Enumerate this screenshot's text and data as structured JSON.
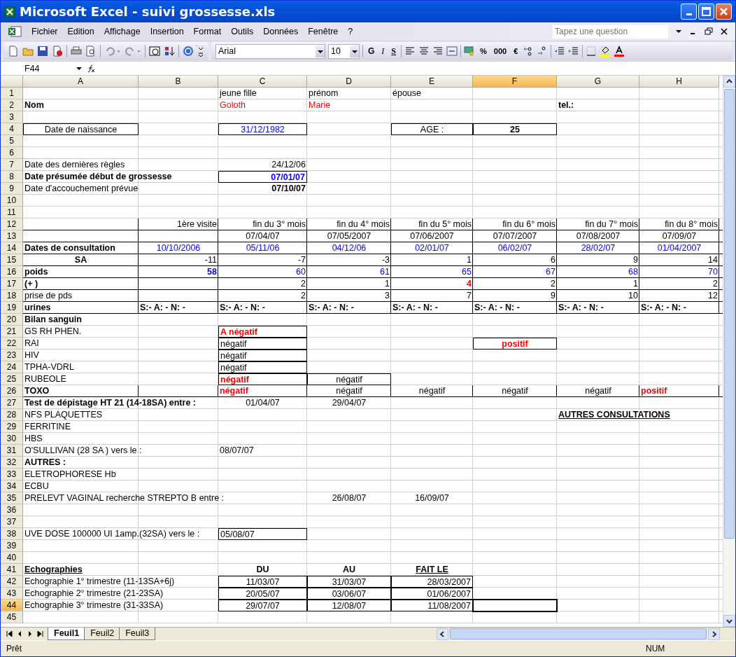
{
  "window": {
    "title": "Microsoft Excel - suivi grossesse.xls"
  },
  "menu": [
    "Fichier",
    "Edition",
    "Affichage",
    "Insertion",
    "Format",
    "Outils",
    "Données",
    "Fenêtre",
    "?"
  ],
  "help_box": {
    "placeholder": "Tapez une question"
  },
  "font_box": {
    "value": "Arial"
  },
  "size_box": {
    "value": "10"
  },
  "format_buttons": [
    "G",
    "I",
    "S"
  ],
  "number_buttons": [
    "%",
    "000",
    "€"
  ],
  "name_box": {
    "value": "F44"
  },
  "columns": [
    {
      "label": "A",
      "selected": false
    },
    {
      "label": "B",
      "selected": false
    },
    {
      "label": "C",
      "selected": false
    },
    {
      "label": "D",
      "selected": false
    },
    {
      "label": "E",
      "selected": false
    },
    {
      "label": "F",
      "selected": true
    },
    {
      "label": "G",
      "selected": false
    },
    {
      "label": "H",
      "selected": false
    }
  ],
  "rows": [
    {
      "number": "1",
      "selected": false,
      "boxed": false,
      "cells": [
        null,
        null,
        {
          "text": "jeune fille",
          "kind": "text"
        },
        {
          "text": "prénom",
          "kind": "text"
        },
        {
          "text": "épouse",
          "kind": "text"
        }
      ]
    },
    {
      "number": "2",
      "selected": false,
      "boxed": false,
      "cells": [
        {
          "text": "Nom",
          "kind": "text",
          "bold": true
        },
        null,
        {
          "text": "Goloth",
          "kind": "text",
          "color": "#ff0000"
        },
        {
          "text": "Marie",
          "kind": "text",
          "color": "#ff0000"
        },
        null,
        null,
        {
          "text": "tel.:",
          "kind": "text",
          "bold": true
        }
      ]
    },
    {
      "number": "3",
      "selected": false,
      "boxed": false
    },
    {
      "number": "4",
      "selected": false,
      "boxed": false,
      "cells": [
        {
          "text": "Date de naissance",
          "kind": "centered",
          "boxed": true
        },
        null,
        {
          "text": "31/12/1982",
          "kind": "centered",
          "color": "#0000ff",
          "boxed": true
        },
        null,
        {
          "text": "AGE :",
          "kind": "centered",
          "boxed": true
        },
        {
          "text": "25",
          "kind": "centered",
          "bold": true,
          "boxed": true
        }
      ]
    },
    {
      "number": "5",
      "selected": false,
      "boxed": false
    },
    {
      "number": "6",
      "selected": false,
      "boxed": false
    },
    {
      "number": "7",
      "selected": false,
      "boxed": false,
      "cells": [
        {
          "text": "Date des dernières règles",
          "kind": "text"
        },
        null,
        {
          "text": "24/12/06",
          "kind": "figure"
        }
      ]
    },
    {
      "number": "8",
      "selected": false,
      "boxed": false,
      "cells": [
        {
          "text": "Date présumée début de grossesse",
          "kind": "text",
          "bold": true
        },
        null,
        {
          "text": "07/01/07",
          "kind": "figure",
          "bold": true,
          "color": "#0000ff",
          "boxed": true
        }
      ]
    },
    {
      "number": "9",
      "selected": false,
      "boxed": false,
      "cells": [
        {
          "text": "Date d'accouchement prévue",
          "kind": "text"
        },
        null,
        {
          "text": "07/10/07",
          "kind": "figure",
          "bold": true
        }
      ]
    },
    {
      "number": "10",
      "selected": false,
      "boxed": false
    },
    {
      "number": "11",
      "selected": false,
      "boxed": false
    },
    {
      "number": "12",
      "selected": false,
      "boxed": true,
      "cells": [
        null,
        {
          "text": "1ère visite",
          "kind": "figure"
        },
        {
          "text": "fin du 3° mois",
          "kind": "figure"
        },
        {
          "text": "fin du 4° mois",
          "kind": "figure"
        },
        {
          "text": "fin du 5° mois",
          "kind": "figure"
        },
        {
          "text": "fin du 6° mois",
          "kind": "figure"
        },
        {
          "text": "fin du 7° mois",
          "kind": "figure"
        },
        {
          "text": "fin du 8° mois",
          "kind": "figure"
        }
      ]
    },
    {
      "number": "13",
      "selected": false,
      "boxed": true,
      "cells": [
        null,
        null,
        {
          "text": "07/04/07",
          "kind": "centered"
        },
        {
          "text": "07/05/2007",
          "kind": "centered"
        },
        {
          "text": "07/06/2007",
          "kind": "centered"
        },
        {
          "text": "07/07/2007",
          "kind": "centered"
        },
        {
          "text": "07/08/2007",
          "kind": "centered"
        },
        {
          "text": "07/09/07",
          "kind": "centered"
        }
      ]
    },
    {
      "number": "14",
      "selected": false,
      "boxed": true,
      "cells": [
        {
          "text": "Dates de consultation",
          "kind": "text",
          "bold": true
        },
        {
          "text": "10/10/2006",
          "kind": "centered",
          "color": "#0000ff"
        },
        {
          "text": "05/11/06",
          "kind": "centered",
          "color": "#0000ff"
        },
        {
          "text": "04/12/06",
          "kind": "centered",
          "color": "#0000ff"
        },
        {
          "text": "02/01/07",
          "kind": "centered",
          "color": "#0000ff"
        },
        {
          "text": "06/02/07",
          "kind": "centered",
          "color": "#0000ff"
        },
        {
          "text": "28/02/07",
          "kind": "centered",
          "color": "#0000ff"
        },
        {
          "text": "01/04/2007",
          "kind": "centered",
          "color": "#0000ff"
        }
      ]
    },
    {
      "number": "15",
      "selected": false,
      "boxed": true,
      "cells": [
        {
          "text": "SA",
          "kind": "centered",
          "bold": true
        },
        {
          "text": "-11",
          "kind": "figure"
        },
        {
          "text": "-7",
          "kind": "figure"
        },
        {
          "text": "-3",
          "kind": "figure"
        },
        {
          "text": "1",
          "kind": "figure"
        },
        {
          "text": "6",
          "kind": "figure"
        },
        {
          "text": "9",
          "kind": "figure"
        },
        {
          "text": "14",
          "kind": "figure"
        }
      ]
    },
    {
      "number": "16",
      "selected": false,
      "boxed": true,
      "cells": [
        {
          "text": "poids",
          "kind": "text",
          "bold": true
        },
        {
          "text": "58",
          "kind": "figure",
          "bold": true,
          "color": "#0000ff"
        },
        {
          "text": "60",
          "kind": "figure",
          "color": "#0000ff"
        },
        {
          "text": "61",
          "kind": "figure",
          "color": "#0000ff"
        },
        {
          "text": "65",
          "kind": "figure",
          "color": "#0000ff"
        },
        {
          "text": "67",
          "kind": "figure",
          "color": "#0000ff"
        },
        {
          "text": "68",
          "kind": "figure",
          "color": "#0000ff"
        },
        {
          "text": "70",
          "kind": "figure",
          "color": "#0000ff"
        }
      ]
    },
    {
      "number": "17",
      "selected": false,
      "boxed": true,
      "cells": [
        {
          "text": "(+   )",
          "kind": "text",
          "bold": true
        },
        null,
        {
          "text": "2",
          "kind": "figure"
        },
        {
          "text": "1",
          "kind": "figure"
        },
        {
          "text": "4",
          "kind": "figure",
          "bold": true,
          "color": "#ff0000"
        },
        {
          "text": "2",
          "kind": "figure"
        },
        {
          "text": "1",
          "kind": "figure"
        },
        {
          "text": "2",
          "kind": "figure"
        }
      ]
    },
    {
      "number": "18",
      "selected": false,
      "boxed": true,
      "cells": [
        {
          "text": "prise de pds",
          "kind": "text"
        },
        null,
        {
          "text": "2",
          "kind": "figure"
        },
        {
          "text": "3",
          "kind": "figure"
        },
        {
          "text": "7",
          "kind": "figure"
        },
        {
          "text": "9",
          "kind": "figure"
        },
        {
          "text": "10",
          "kind": "figure"
        },
        {
          "text": "12",
          "kind": "figure"
        }
      ]
    },
    {
      "number": "19",
      "selected": false,
      "boxed": true,
      "cells": [
        {
          "text": "urines",
          "kind": "text",
          "bold": true
        },
        {
          "text": "S:-  A: -  N: -",
          "kind": "text",
          "bold": true
        },
        {
          "text": "S:-  A: -  N: -",
          "kind": "text",
          "bold": true
        },
        {
          "text": "S:-  A: -  N: -",
          "kind": "text",
          "bold": true
        },
        {
          "text": "S:-  A: -  N: -",
          "kind": "text",
          "bold": true
        },
        {
          "text": "S:-  A: -  N: -",
          "kind": "text",
          "bold": true
        },
        {
          "text": "S:-  A: -  N: -",
          "kind": "text",
          "bold": true
        },
        {
          "text": "S:-  A: -  N: -",
          "kind": "text",
          "bold": true
        }
      ]
    },
    {
      "number": "20",
      "selected": false,
      "boxed": false,
      "cells": [
        {
          "text": "Bilan sanguin",
          "kind": "text",
          "bold": true
        }
      ]
    },
    {
      "number": "21",
      "selected": false,
      "boxed": false,
      "cells": [
        {
          "text": "GS RH PHEN.",
          "kind": "text"
        },
        null,
        {
          "text": "A négatif",
          "kind": "text",
          "bold": true,
          "color": "#ff0000",
          "boxed": true
        }
      ]
    },
    {
      "number": "22",
      "selected": false,
      "boxed": false,
      "cells": [
        {
          "text": "RAI",
          "kind": "text"
        },
        null,
        {
          "text": "négatif",
          "kind": "text",
          "boxed": true
        },
        null,
        null,
        {
          "text": "positif",
          "kind": "centered",
          "bold": true,
          "color": "#ff0000",
          "boxed": true
        }
      ]
    },
    {
      "number": "23",
      "selected": false,
      "boxed": false,
      "cells": [
        {
          "text": "HIV",
          "kind": "text"
        },
        null,
        {
          "text": "négatif",
          "kind": "text",
          "boxed": true
        }
      ]
    },
    {
      "number": "24",
      "selected": false,
      "boxed": false,
      "cells": [
        {
          "text": "TPHA-VDRL",
          "kind": "text"
        },
        null,
        {
          "text": "négatif",
          "kind": "text",
          "boxed": true
        }
      ]
    },
    {
      "number": "25",
      "selected": false,
      "boxed": false,
      "cells": [
        {
          "text": "RUBEOLE",
          "kind": "text"
        },
        null,
        {
          "text": "négatif",
          "kind": "text",
          "bold": true,
          "color": "#ff0000",
          "boxed": true
        },
        {
          "text": "négatif",
          "kind": "centered",
          "boxed": true
        }
      ]
    },
    {
      "number": "26",
      "selected": false,
      "boxed": true,
      "cells": [
        {
          "text": "TOXO",
          "kind": "text",
          "bold": true
        },
        null,
        {
          "text": "négatif",
          "kind": "text",
          "bold": true,
          "color": "#ff0000"
        },
        {
          "text": "négatif",
          "kind": "centered"
        },
        {
          "text": "négatif",
          "kind": "centered"
        },
        {
          "text": "négatif",
          "kind": "centered"
        },
        {
          "text": "négatif",
          "kind": "centered"
        },
        {
          "text": "positif",
          "kind": "text",
          "bold": true,
          "color": "#ff0000"
        }
      ]
    },
    {
      "number": "27",
      "selected": false,
      "boxed": false,
      "cells": [
        {
          "text": "Test de dépistage HT 21 (14-18SA) entre :",
          "kind": "text",
          "bold": true
        },
        null,
        {
          "text": "01/04/07",
          "kind": "centered"
        },
        {
          "text": "29/04/07",
          "kind": "centered"
        }
      ]
    },
    {
      "number": "28",
      "selected": false,
      "boxed": false,
      "cells": [
        {
          "text": "NFS PLAQUETTES",
          "kind": "text"
        },
        null,
        null,
        null,
        null,
        null,
        {
          "text": "AUTRES CONSULTATIONS",
          "kind": "text",
          "bold": true,
          "underlined": true
        }
      ]
    },
    {
      "number": "29",
      "selected": false,
      "boxed": false,
      "cells": [
        {
          "text": "FERRITINE",
          "kind": "text"
        }
      ]
    },
    {
      "number": "30",
      "selected": false,
      "boxed": false,
      "cells": [
        {
          "text": "HBS",
          "kind": "text"
        }
      ]
    },
    {
      "number": "31",
      "selected": false,
      "boxed": false,
      "cells": [
        {
          "text": "O'SULLIVAN (28 SA ) vers le :",
          "kind": "text"
        },
        null,
        {
          "text": "08/07/07",
          "kind": "text"
        }
      ]
    },
    {
      "number": "32",
      "selected": false,
      "boxed": false,
      "cells": [
        {
          "text": "AUTRES :",
          "kind": "text",
          "bold": true
        }
      ]
    },
    {
      "number": "33",
      "selected": false,
      "boxed": false,
      "cells": [
        {
          "text": "ELETROPHORESE Hb",
          "kind": "text"
        }
      ]
    },
    {
      "number": "34",
      "selected": false,
      "boxed": false,
      "cells": [
        {
          "text": "ECBU",
          "kind": "text"
        }
      ]
    },
    {
      "number": "35",
      "selected": false,
      "boxed": false,
      "cells": [
        {
          "text": "PRELEVT VAGINAL recherche STREPTO B entre :",
          "kind": "text"
        },
        null,
        null,
        {
          "text": "26/08/07",
          "kind": "centered"
        },
        {
          "text": "16/09/07",
          "kind": "centered"
        }
      ]
    },
    {
      "number": "36",
      "selected": false,
      "boxed": false
    },
    {
      "number": "37",
      "selected": false,
      "boxed": false
    },
    {
      "number": "38",
      "selected": false,
      "boxed": false,
      "cells": [
        {
          "text": "UVE DOSE 100000 UI 1amp.(32SA) vers le :",
          "kind": "text"
        },
        null,
        {
          "text": "05/08/07",
          "kind": "text",
          "boxed": true
        }
      ]
    },
    {
      "number": "39",
      "selected": false,
      "boxed": false
    },
    {
      "number": "40",
      "selected": false,
      "boxed": false
    },
    {
      "number": "41",
      "selected": false,
      "boxed": false,
      "cells": [
        {
          "text": "Echographies",
          "kind": "text",
          "bold": true,
          "underlined": true
        },
        null,
        {
          "text": "DU",
          "kind": "centered",
          "bold": true
        },
        {
          "text": "AU",
          "kind": "centered",
          "bold": true
        },
        {
          "text": "FAIT LE",
          "kind": "centered",
          "bold": true,
          "underlined": true
        }
      ]
    },
    {
      "number": "42",
      "selected": false,
      "boxed": false,
      "cells": [
        {
          "text": "Echographie 1° trimestre (11-13SA+6j)",
          "kind": "text"
        },
        null,
        {
          "text": "11/03/07",
          "kind": "centered",
          "boxed": true
        },
        {
          "text": "31/03/07",
          "kind": "centered",
          "boxed": true
        },
        {
          "text": "28/03/2007",
          "kind": "figure",
          "boxed": true
        }
      ]
    },
    {
      "number": "43",
      "selected": false,
      "boxed": false,
      "cells": [
        {
          "text": "Echographie 2° trimestre (21-23SA)",
          "kind": "text"
        },
        null,
        {
          "text": "20/05/07",
          "kind": "centered",
          "boxed": true
        },
        {
          "text": "03/06/07",
          "kind": "centered",
          "boxed": true
        },
        {
          "text": "01/06/2007",
          "kind": "figure",
          "boxed": true
        }
      ]
    },
    {
      "number": "44",
      "selected": true,
      "boxed": false,
      "cells": [
        {
          "text": "Echographie 3° trimestre (31-33SA)",
          "kind": "text"
        },
        null,
        {
          "text": "29/07/07",
          "kind": "centered",
          "boxed": true
        },
        {
          "text": "12/08/07",
          "kind": "centered",
          "boxed": true
        },
        {
          "text": "11/08/2007",
          "kind": "figure",
          "boxed": true
        }
      ]
    },
    {
      "number": "45",
      "selected": false,
      "boxed": false
    }
  ],
  "sheet_tabs": [
    {
      "label": "Feuil1",
      "selected": true
    },
    {
      "label": "Feuil2",
      "selected": false
    },
    {
      "label": "Feuil3",
      "selected": false
    }
  ],
  "status_bar": {
    "text": "Prêt",
    "indicator": "NUM"
  }
}
